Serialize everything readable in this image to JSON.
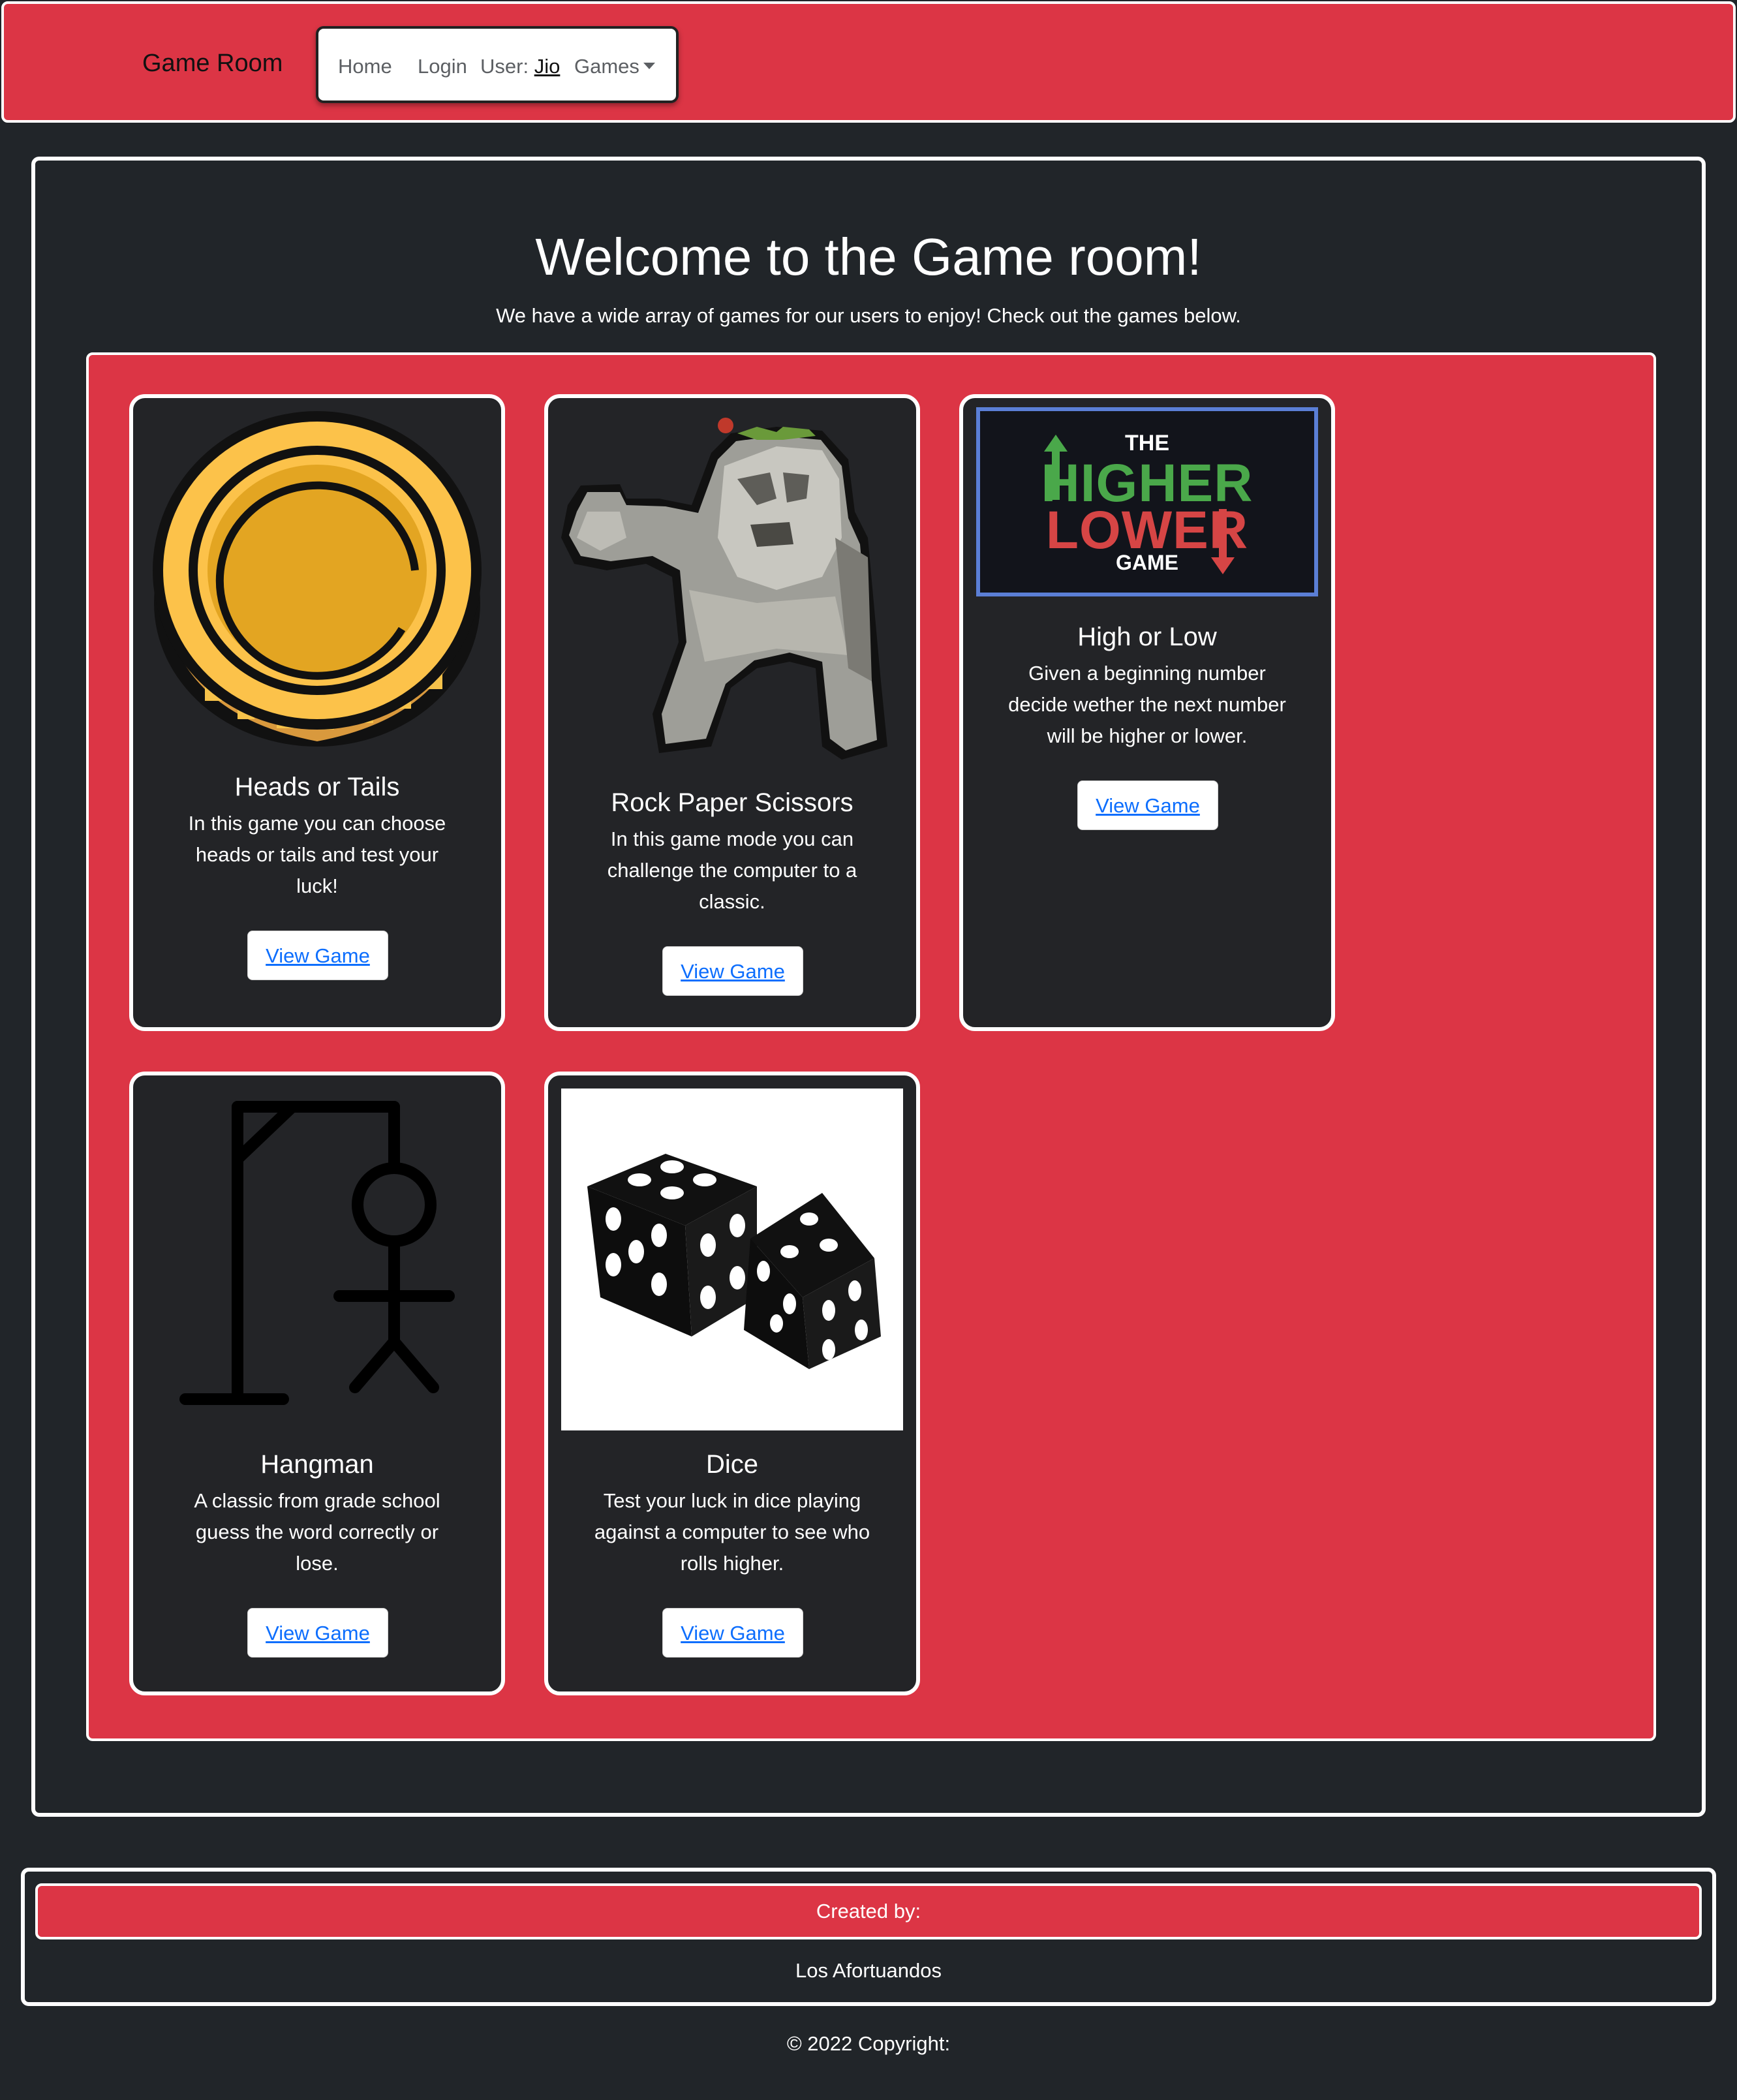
{
  "navbar": {
    "brand": "Game Room",
    "home": "Home",
    "login": "Login",
    "user_label": "User:",
    "user_name": "Jio",
    "games": "Games"
  },
  "main": {
    "title": "Welcome to the Game room!",
    "subtitle": "We have a wide array of games for our users to enjoy! Check out the games below."
  },
  "cards": [
    {
      "title": "Heads or Tails",
      "text": "In this game you can choose heads or tails and test your luck!",
      "button": "View Game",
      "image": "coin-image"
    },
    {
      "title": "Rock Paper Scissors",
      "text": "In this game mode you can challenge the computer to a classic.",
      "button": "View Game",
      "image": "rock-golem-image"
    },
    {
      "title": "High or Low",
      "text": "Given a beginning number decide wether the next number will be higher or lower.",
      "button": "View Game",
      "image": "higher-lower-logo",
      "logo_text": {
        "the": "THE",
        "higher": "HIGHER",
        "lower": "LOWER",
        "game": "GAME"
      }
    },
    {
      "title": "Hangman",
      "text": "A classic from grade school guess the word correctly or lose.",
      "button": "View Game",
      "image": "hangman-image"
    },
    {
      "title": "Dice",
      "text": "Test your luck in dice playing against a computer to see who rolls higher.",
      "button": "View Game",
      "image": "dice-image"
    }
  ],
  "footer": {
    "created_by": "Created by:",
    "team": "Los Afortuandos",
    "copyright": "© 2022 Copyright:"
  },
  "colors": {
    "accent": "#dc3545",
    "background": "#212529",
    "card": "#232427",
    "link": "#0d6efd"
  }
}
